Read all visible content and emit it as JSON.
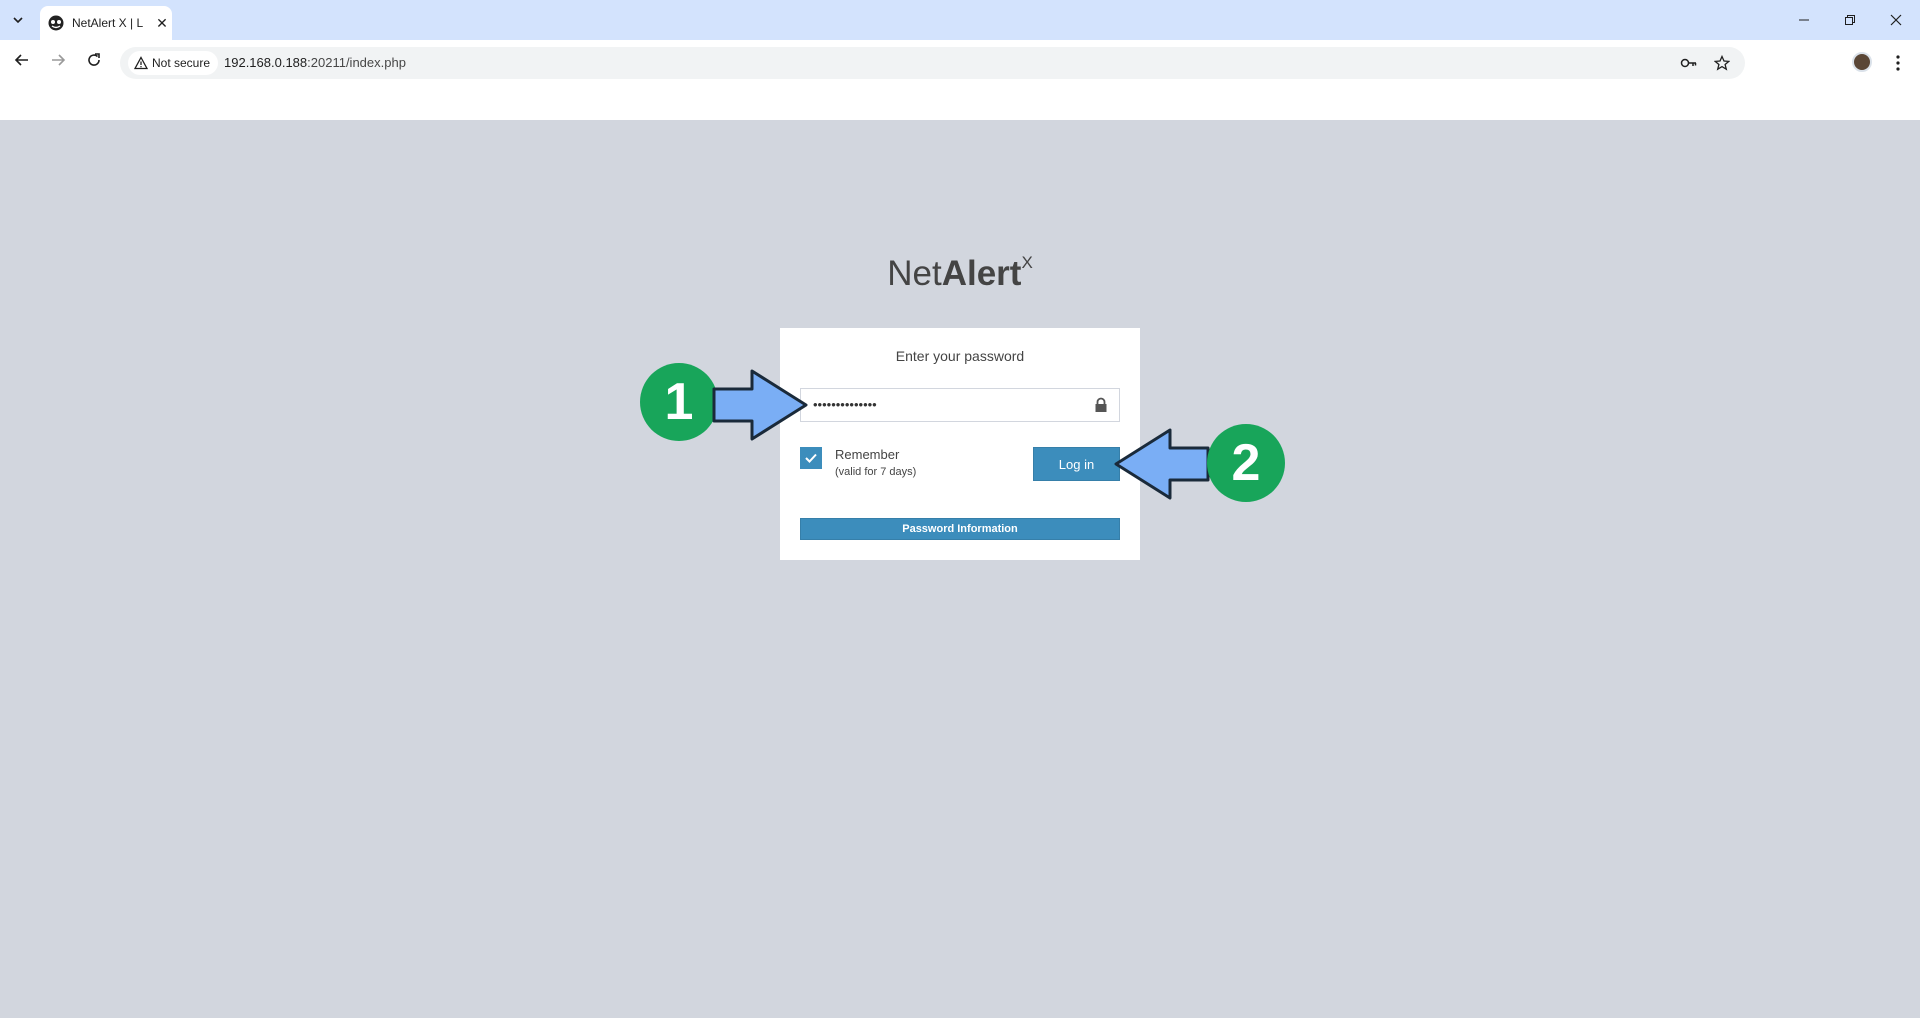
{
  "browser": {
    "tab_title": "NetAlert X | L",
    "security_label": "Not secure",
    "url_host": "192.168.0.188",
    "url_path": ":20211/index.php"
  },
  "login": {
    "logo_net": "Net",
    "logo_alert": "Alert",
    "logo_sup": "X",
    "prompt": "Enter your password",
    "password_value": "••••••••••••••",
    "remember_label": "Remember",
    "remember_note": "(valid for 7 days)",
    "remember_checked": true,
    "login_button": "Log in",
    "info_button": "Password Information"
  },
  "annotations": {
    "step1": "1",
    "step2": "2",
    "badge_color": "#18a55a",
    "arrow_color": "#7aaef5"
  },
  "colors": {
    "page_bg": "#d2d6de",
    "primary": "#3c8dbc"
  }
}
